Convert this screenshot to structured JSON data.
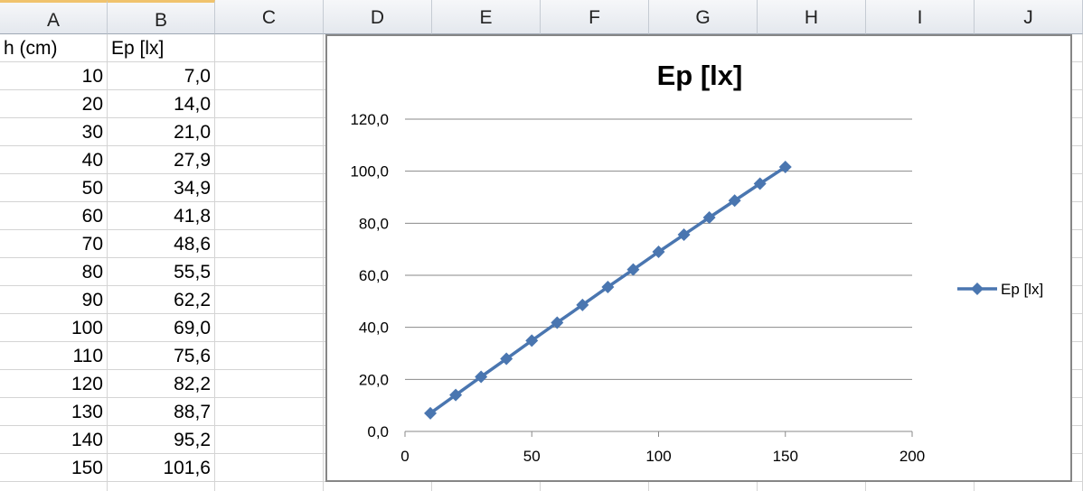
{
  "columns": [
    "A",
    "B",
    "C",
    "D",
    "E",
    "F",
    "G",
    "H",
    "I",
    "J"
  ],
  "table": {
    "header_a": "h (cm)",
    "header_b": "Ep [lx]",
    "rows": [
      {
        "h": "10",
        "ep": "7,0"
      },
      {
        "h": "20",
        "ep": "14,0"
      },
      {
        "h": "30",
        "ep": "21,0"
      },
      {
        "h": "40",
        "ep": "27,9"
      },
      {
        "h": "50",
        "ep": "34,9"
      },
      {
        "h": "60",
        "ep": "41,8"
      },
      {
        "h": "70",
        "ep": "48,6"
      },
      {
        "h": "80",
        "ep": "55,5"
      },
      {
        "h": "90",
        "ep": "62,2"
      },
      {
        "h": "100",
        "ep": "69,0"
      },
      {
        "h": "110",
        "ep": "75,6"
      },
      {
        "h": "120",
        "ep": "82,2"
      },
      {
        "h": "130",
        "ep": "88,7"
      },
      {
        "h": "140",
        "ep": "95,2"
      },
      {
        "h": "150",
        "ep": "101,6"
      }
    ]
  },
  "chart_data": {
    "type": "line",
    "title": "Ep [lx]",
    "xlabel": "",
    "ylabel": "",
    "xlim": [
      0,
      200
    ],
    "ylim": [
      0,
      120
    ],
    "x_ticks": [
      "0",
      "50",
      "100",
      "150",
      "200"
    ],
    "y_ticks": [
      "0,0",
      "20,0",
      "40,0",
      "60,0",
      "80,0",
      "100,0",
      "120,0"
    ],
    "grid": "horizontal",
    "legend_position": "right",
    "series_color": "#4a76b0",
    "series": [
      {
        "name": "Ep [lx]",
        "x": [
          10,
          20,
          30,
          40,
          50,
          60,
          70,
          80,
          90,
          100,
          110,
          120,
          130,
          140,
          150
        ],
        "values": [
          7.0,
          14.0,
          21.0,
          27.9,
          34.9,
          41.8,
          48.6,
          55.5,
          62.2,
          69.0,
          75.6,
          82.2,
          88.7,
          95.2,
          101.6
        ]
      }
    ]
  }
}
